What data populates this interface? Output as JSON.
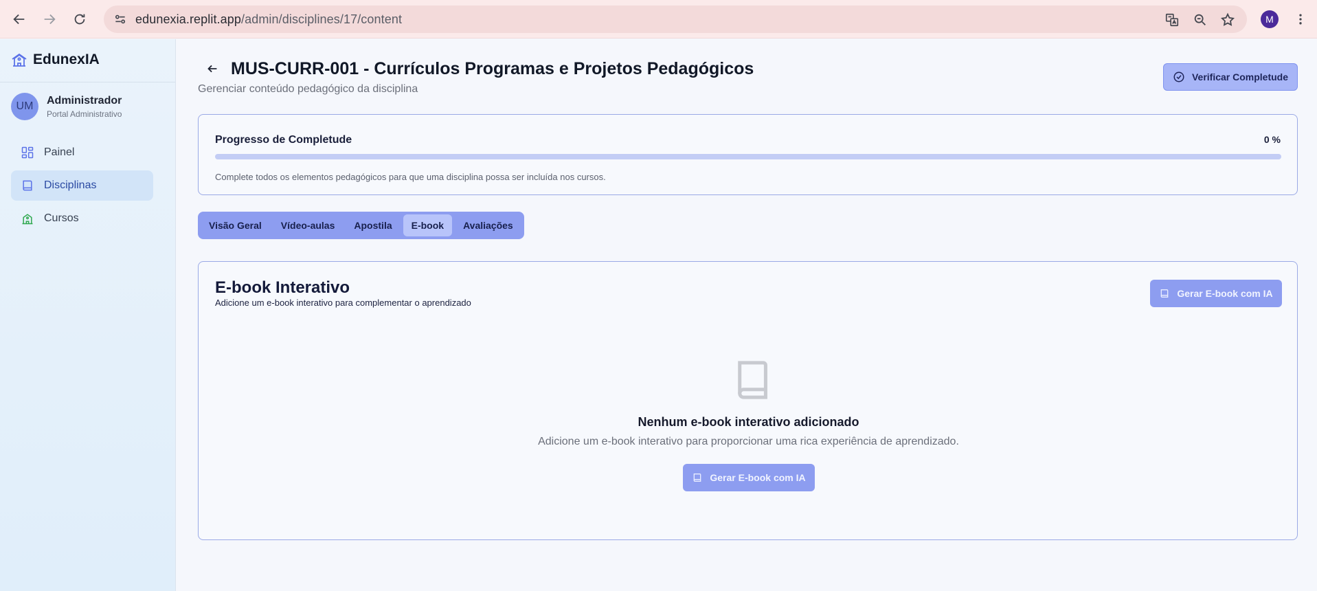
{
  "browser": {
    "url_host": "edunexia.replit.app",
    "url_path": "/admin/disciplines/17/content",
    "profile_initial": "M"
  },
  "sidebar": {
    "brand": "EdunexIA",
    "user": {
      "initials": "UM",
      "name": "Administrador",
      "role": "Portal Administrativo"
    },
    "items": [
      {
        "label": "Painel",
        "icon": "dashboard-icon",
        "active": false
      },
      {
        "label": "Disciplinas",
        "icon": "book-icon",
        "active": true
      },
      {
        "label": "Cursos",
        "icon": "school-icon",
        "active": false
      }
    ]
  },
  "header": {
    "title": "MUS-CURR-001 - Currículos Programas e Projetos Pedagógicos",
    "subtitle": "Gerenciar conteúdo pedagógico da disciplina",
    "verify_label": "Verificar Completude"
  },
  "progress": {
    "label": "Progresso de Completude",
    "value_text": "0 %",
    "percent": 0,
    "hint": "Complete todos os elementos pedagógicos para que uma disciplina possa ser incluída nos cursos."
  },
  "tabs": [
    {
      "label": "Visão Geral",
      "active": false
    },
    {
      "label": "Vídeo-aulas",
      "active": false
    },
    {
      "label": "Apostila",
      "active": false
    },
    {
      "label": "E-book",
      "active": true
    },
    {
      "label": "Avaliações",
      "active": false
    }
  ],
  "ebook": {
    "title": "E-book Interativo",
    "description": "Adicione um e-book interativo para complementar o aprendizado",
    "generate_label": "Gerar E-book com IA",
    "empty_title": "Nenhum e-book interativo adicionado",
    "empty_description": "Adicione um e-book interativo para proporcionar uma rica experiência de aprendizado.",
    "empty_generate_label": "Gerar E-book com IA"
  },
  "colors": {
    "accent": "#5b72e8",
    "tab_bar": "#8d9df0",
    "card_border": "#9aa9e6"
  }
}
